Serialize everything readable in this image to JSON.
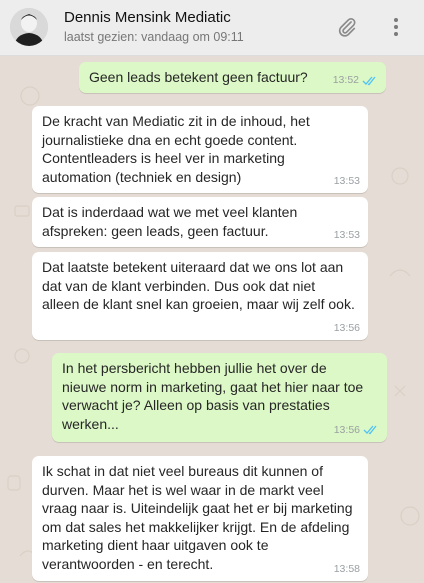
{
  "header": {
    "name": "Dennis Mensink Mediatic",
    "status": "laatst gezien: vandaag om 09:11",
    "icons": [
      "paperclip-icon",
      "menu-dots-icon"
    ]
  },
  "colors": {
    "chat_background": "#e5ddd5",
    "incoming_bubble": "#ffffff",
    "outgoing_bubble": "#dcf8c6",
    "read_ticks": "#4fc3f7",
    "header_background": "#ededed"
  },
  "messages": [
    {
      "direction": "out",
      "text": "Geen leads betekent geen factuur?",
      "time": "13:52",
      "read": true
    },
    {
      "direction": "in",
      "text": "De kracht van Mediatic zit in de inhoud, het\njournalistieke dna en echt goede content.\nContentleaders is heel ver in marketing\nautomation (techniek en design)",
      "time": "13:53"
    },
    {
      "direction": "in",
      "text": "Dat is inderdaad wat we met veel klanten\nafspreken: geen leads, geen factuur.",
      "time": "13:53"
    },
    {
      "direction": "in",
      "text": "Dat laatste betekent uiteraard dat we ons lot aan\ndat van de klant verbinden. Dus ook dat niet\nalleen de klant snel kan groeien, maar wij zelf ook.",
      "time": "13:56"
    },
    {
      "direction": "out",
      "text": "In het persbericht hebben jullie het over de\nnieuwe norm in marketing, gaat het hier naar toe\nverwacht je? Alleen op basis van prestaties\nwerken...",
      "time": "13:56",
      "read": true
    },
    {
      "direction": "in",
      "text": "Ik schat in dat niet veel bureaus dit kunnen of\ndurven. Maar het is wel waar in de markt veel\nvraag naar is. Uiteindelijk gaat het er bij marketing\nom dat sales het makkelijker krijgt. En de afdeling\nmarketing dient haar uitgaven ook te\nverantwoorden - en terecht.",
      "time": "13:58"
    }
  ]
}
